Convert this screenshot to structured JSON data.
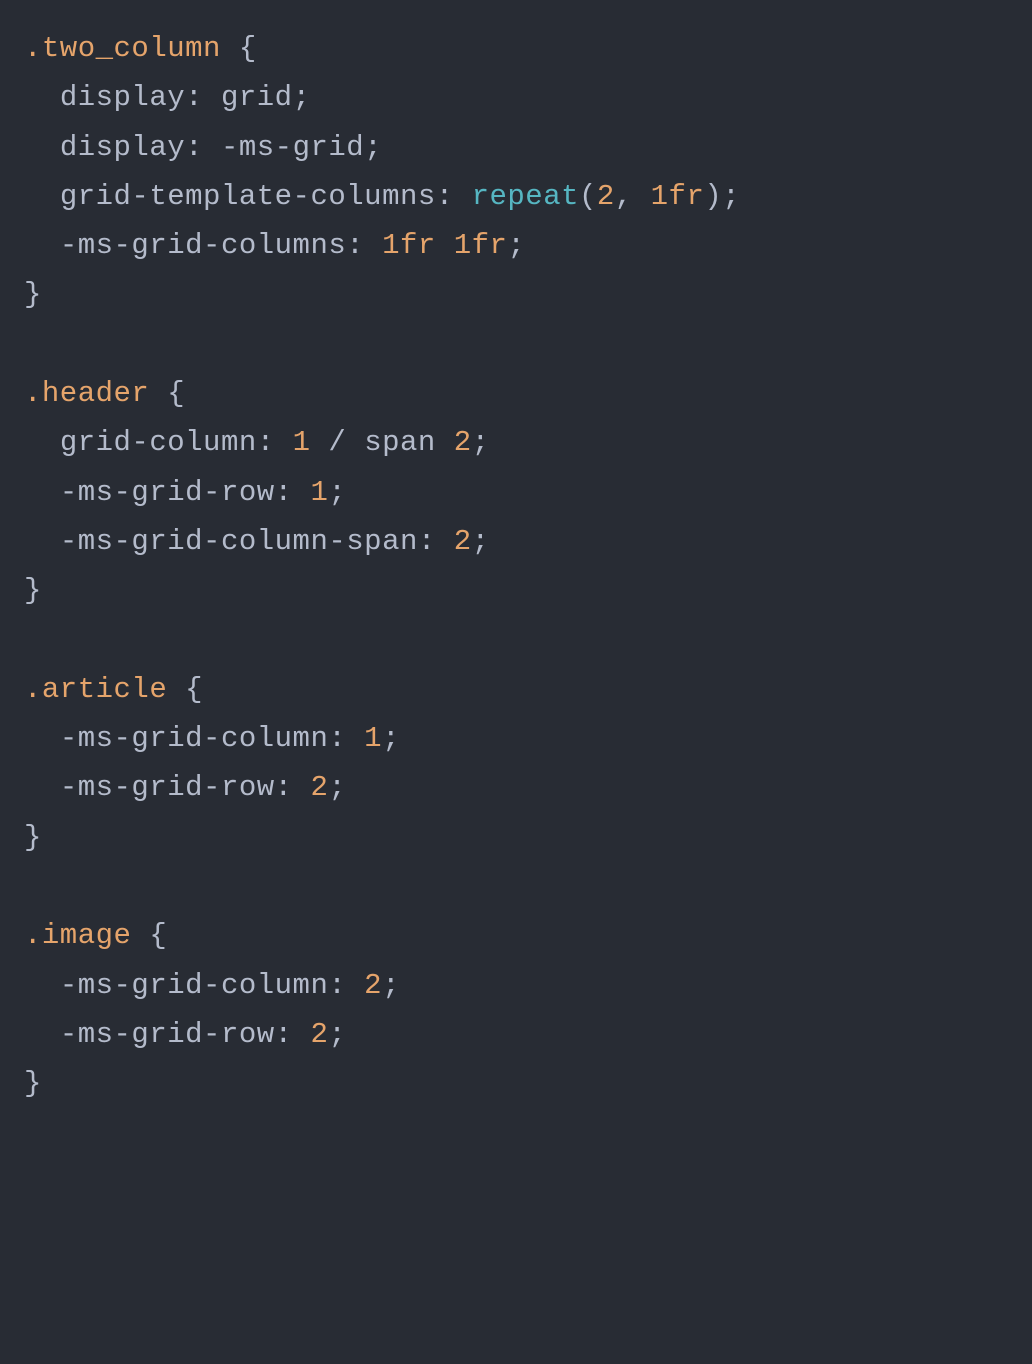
{
  "code": {
    "rules": [
      {
        "selector": ".two_column",
        "declarations": [
          {
            "prop": "display",
            "value": [
              {
                "t": "val",
                "v": "grid"
              }
            ]
          },
          {
            "prop": "display",
            "value": [
              {
                "t": "val",
                "v": "-ms-grid"
              }
            ]
          },
          {
            "prop": "grid-template-columns",
            "value": [
              {
                "t": "fn",
                "v": "repeat"
              },
              {
                "t": "punc",
                "v": "("
              },
              {
                "t": "num",
                "v": "2"
              },
              {
                "t": "punc",
                "v": ", "
              },
              {
                "t": "num",
                "v": "1"
              },
              {
                "t": "unit",
                "v": "fr"
              },
              {
                "t": "punc",
                "v": ")"
              }
            ]
          },
          {
            "prop": "-ms-grid-columns",
            "value": [
              {
                "t": "num",
                "v": "1"
              },
              {
                "t": "unit",
                "v": "fr "
              },
              {
                "t": "num",
                "v": "1"
              },
              {
                "t": "unit",
                "v": "fr"
              }
            ]
          }
        ]
      },
      {
        "selector": ".header",
        "declarations": [
          {
            "prop": "grid-column",
            "value": [
              {
                "t": "num",
                "v": "1"
              },
              {
                "t": "punc",
                "v": " / "
              },
              {
                "t": "kw",
                "v": "span "
              },
              {
                "t": "num",
                "v": "2"
              }
            ]
          },
          {
            "prop": "-ms-grid-row",
            "value": [
              {
                "t": "num",
                "v": "1"
              }
            ]
          },
          {
            "prop": "-ms-grid-column-span",
            "value": [
              {
                "t": "num",
                "v": "2"
              }
            ]
          }
        ]
      },
      {
        "selector": ".article",
        "declarations": [
          {
            "prop": "-ms-grid-column",
            "value": [
              {
                "t": "num",
                "v": "1"
              }
            ]
          },
          {
            "prop": "-ms-grid-row",
            "value": [
              {
                "t": "num",
                "v": "2"
              }
            ]
          }
        ]
      },
      {
        "selector": ".image",
        "declarations": [
          {
            "prop": "-ms-grid-column",
            "value": [
              {
                "t": "num",
                "v": "2"
              }
            ]
          },
          {
            "prop": "-ms-grid-row",
            "value": [
              {
                "t": "num",
                "v": "2"
              }
            ]
          }
        ]
      }
    ]
  }
}
